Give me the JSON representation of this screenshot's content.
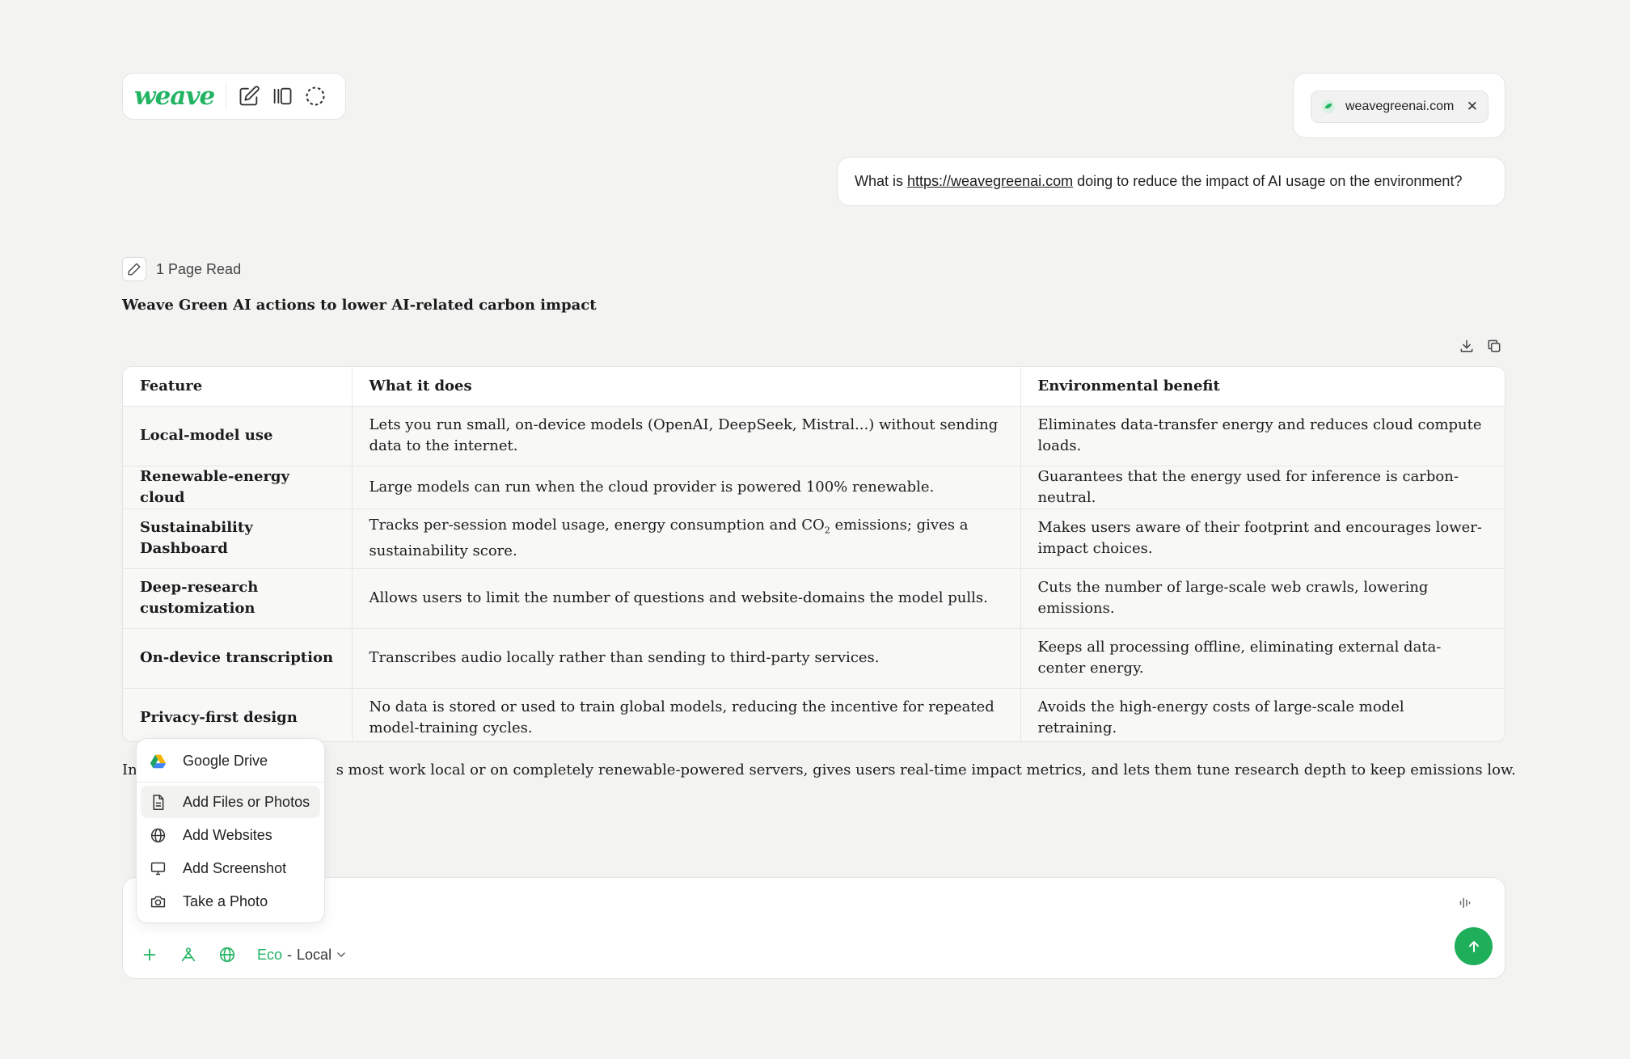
{
  "app": {
    "logo_text": "weave",
    "brand_color": "#22b463",
    "toolbar_icons": [
      "new-chat-icon",
      "sidebar-toggle-icon",
      "circle-selection-icon"
    ]
  },
  "source": {
    "domain": "weavegreenai.com",
    "close_symbol": "✕"
  },
  "user_message": {
    "prefix": "What is",
    "link": "https://weavegreenai.com",
    "suffix": "doing to reduce the impact of AI usage on the environment?"
  },
  "pages_read": "1 Page Read",
  "answer": {
    "title": "Weave Green AI actions to lower AI-related carbon impact",
    "table": {
      "headers": [
        "Feature",
        "What it does",
        "Environmental benefit"
      ],
      "rows": [
        {
          "feature": "Local-model use",
          "does": "Lets you run small, on-device models (OpenAI, DeepSeek, Mistral...) without sending data to the internet.",
          "benefit": "Eliminates data-transfer energy and reduces cloud compute loads."
        },
        {
          "feature": "Renewable-energy cloud",
          "does": "Large models can run when the cloud provider is powered 100% renewable.",
          "benefit": "Guarantees that the energy used for inference is carbon-neutral."
        },
        {
          "feature": "Sustainability Dashboard",
          "does_a": "Tracks per-session model usage, energy consumption and CO",
          "does_sub": "2",
          "does_b": " emissions; gives a sustainability score.",
          "benefit": "Makes users aware of their footprint and encourages lower-impact choices."
        },
        {
          "feature": "Deep-research customization",
          "does": "Allows users to limit the number of questions and website-domains the model pulls.",
          "benefit": "Cuts the number of large-scale web crawls, lowering emissions."
        },
        {
          "feature": "On-device transcription",
          "does": "Transcribes audio locally rather than sending to third-party services.",
          "benefit": "Keeps all processing offline, eliminating external data-center energy."
        },
        {
          "feature": "Privacy-first design",
          "does": "No data is stored or used to train global models, reducing the incentive for repeated model-training cycles.",
          "benefit": "Avoids the high-energy costs of large-scale model retraining."
        }
      ]
    },
    "summary_start": "In",
    "summary_visible": "s most work local or on completely renewable-powered servers, gives users real-time impact metrics, and lets them tune research depth to keep emissions low."
  },
  "menu": {
    "items": [
      {
        "label": "Google Drive",
        "icon": "google-drive-icon"
      },
      {
        "label": "Add Files or Photos",
        "icon": "file-icon"
      },
      {
        "label": "Add Websites",
        "icon": "globe-icon"
      },
      {
        "label": "Add Screenshot",
        "icon": "monitor-icon"
      },
      {
        "label": "Take a Photo",
        "icon": "camera-icon"
      }
    ]
  },
  "composer": {
    "mode_eco": "Eco",
    "mode_sep": "-",
    "mode_local": "Local",
    "send_color": "#1fae5a"
  }
}
